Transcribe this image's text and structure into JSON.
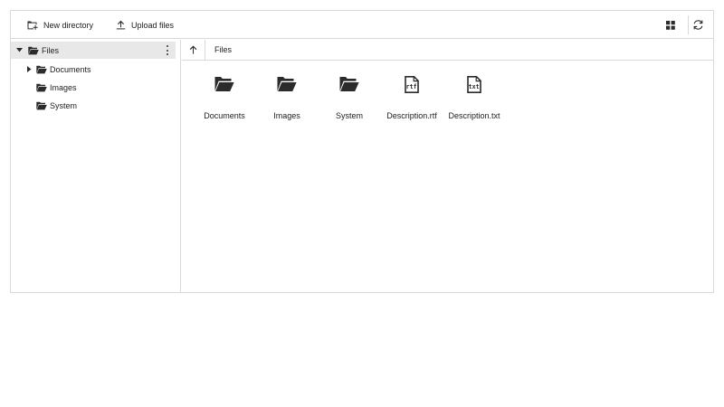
{
  "toolbar": {
    "new_directory_label": "New directory",
    "upload_files_label": "Upload files"
  },
  "navigation": {
    "root": {
      "label": "Files",
      "expanded": true,
      "selected": true
    },
    "children": [
      {
        "label": "Documents",
        "has_children": true,
        "expanded": false
      },
      {
        "label": "Images",
        "has_children": false
      },
      {
        "label": "System",
        "has_children": false
      }
    ]
  },
  "breadcrumb": {
    "path": [
      "Files"
    ]
  },
  "items": [
    {
      "name": "Documents",
      "type": "folder",
      "icon": "folder-open-icon"
    },
    {
      "name": "Images",
      "type": "folder",
      "icon": "folder-open-icon"
    },
    {
      "name": "System",
      "type": "folder",
      "icon": "folder-open-icon"
    },
    {
      "name": "Description.rtf",
      "type": "file",
      "icon": "rtf-file-icon",
      "ext_label": "rtf"
    },
    {
      "name": "Description.txt",
      "type": "file",
      "icon": "txt-file-icon",
      "ext_label": "txt"
    }
  ],
  "colors": {
    "border": "#d9d9d9",
    "selected_row": "#e8e8e8",
    "text": "#212121",
    "icon": "#2b2b2b"
  }
}
